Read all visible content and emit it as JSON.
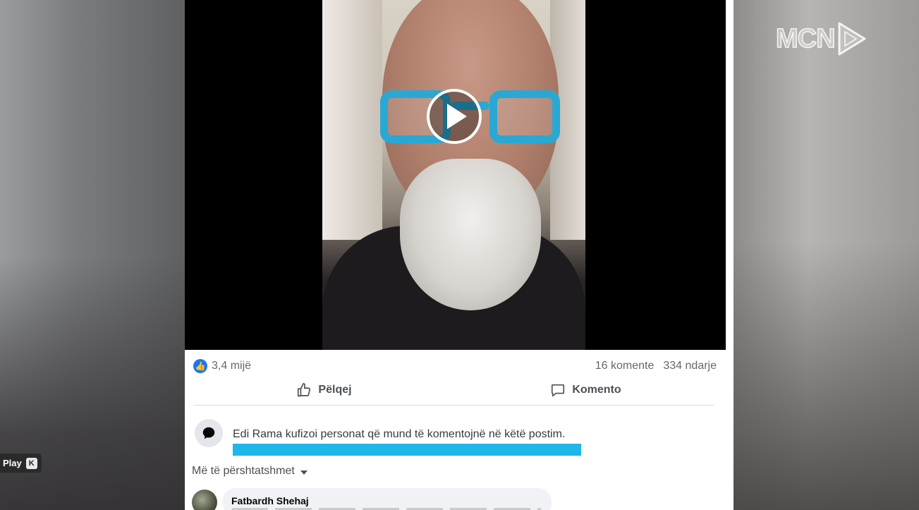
{
  "post": {
    "reactions_count": "3,4 mijë",
    "comments_count": "16 komente",
    "shares_count": "334 ndarje",
    "like_label": "Pëlqej",
    "comment_label": "Komento",
    "restriction_notice": "Edi Rama kufizoi personat që mund të komentojnë në këtë postim.",
    "sort_label": "Më të përshtatshmet",
    "comments": [
      {
        "author": "Fatbardh Shehaj"
      }
    ]
  },
  "player": {
    "play_label": "Play",
    "shortcut_key": "K"
  },
  "overlay": {
    "logo_text": "MCN"
  },
  "colors": {
    "accent_blue": "#1877f2",
    "highlight": "#1fb6ea"
  },
  "icons": {
    "like": "thumbs-up-icon",
    "comment": "speech-bubble-icon",
    "play": "play-icon",
    "logo": "mcn-logo"
  }
}
